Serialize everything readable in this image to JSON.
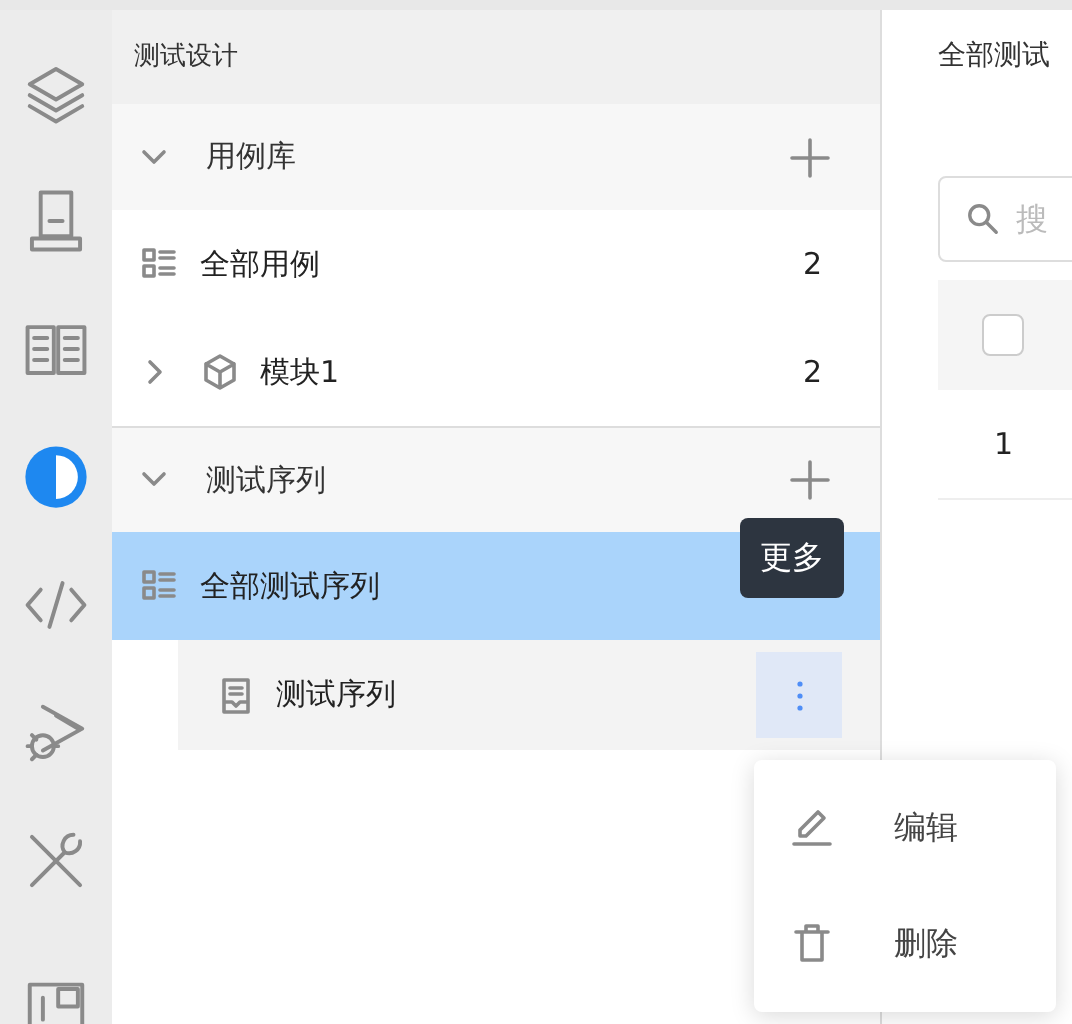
{
  "rail": [
    {
      "kind": "layers",
      "selected": false
    },
    {
      "kind": "stand",
      "selected": false
    },
    {
      "kind": "book",
      "selected": false
    },
    {
      "kind": "contrast",
      "selected": true
    },
    {
      "kind": "code",
      "selected": false
    },
    {
      "kind": "bug",
      "selected": false
    },
    {
      "kind": "tools",
      "selected": false
    },
    {
      "kind": "board",
      "selected": false
    }
  ],
  "panel": {
    "title": "测试设计",
    "sections": [
      {
        "label": "用例库",
        "expanded": true,
        "items": [
          {
            "kind": "all",
            "label": "全部用例",
            "count": "2",
            "selected": false
          },
          {
            "kind": "module",
            "label": "模块1",
            "count": "2",
            "selected": false,
            "expanded": false
          }
        ]
      },
      {
        "label": "测试序列",
        "expanded": true,
        "items": [
          {
            "kind": "all",
            "label": "全部测试序列",
            "selected": true,
            "expanded": true,
            "children": [
              {
                "kind": "sequence",
                "label": "测试序列",
                "selected": false
              }
            ]
          }
        ]
      }
    ]
  },
  "tooltip": "更多",
  "menu": [
    {
      "kind": "edit",
      "label": "编辑"
    },
    {
      "kind": "delete",
      "label": "删除"
    }
  ],
  "main": {
    "title": "全部测试",
    "search": {
      "placeholder": "搜"
    },
    "select_all": {
      "checked": false
    },
    "rows": [
      {
        "column_1": "1"
      }
    ]
  }
}
